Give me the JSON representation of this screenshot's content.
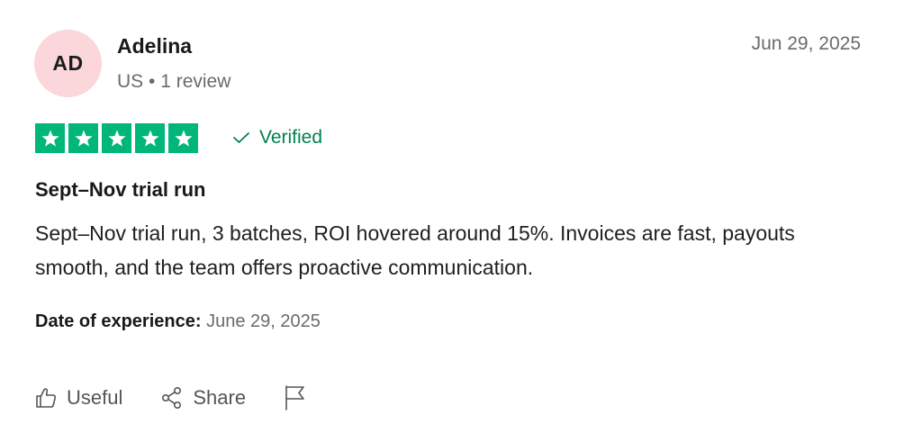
{
  "reviewer": {
    "initials": "AD",
    "name": "Adelina",
    "meta": "US • 1 review"
  },
  "review": {
    "date": "Jun 29, 2025",
    "rating": 5,
    "verified_label": "Verified",
    "title": "Sept–Nov trial run",
    "body": "Sept–Nov trial run, 3 batches, ROI hovered around 15%. Invoices are fast, payouts smooth, and the team offers proactive communication.",
    "experience_label": "Date of experience:",
    "experience_date": "June 29, 2025"
  },
  "actions": {
    "useful_label": "Useful",
    "share_label": "Share"
  },
  "icons": {
    "star": "star-icon",
    "verified": "checkmark-icon",
    "useful": "thumbs-up-icon",
    "share": "share-icon",
    "flag": "flag-icon"
  },
  "colors": {
    "star_green": "#00b67a",
    "verified_green": "#00824d",
    "avatar_pink": "#fbd6db",
    "muted_text": "#6b6b6b"
  }
}
